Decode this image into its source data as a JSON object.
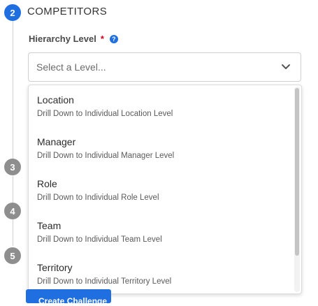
{
  "steps": {
    "active": {
      "number": "2",
      "title": "COMPETITORS"
    },
    "inactive": [
      "3",
      "4",
      "5"
    ]
  },
  "field": {
    "label": "Hierarchy Level",
    "required_mark": "*",
    "help_icon": "question-circle-icon"
  },
  "select": {
    "placeholder": "Select a Level...",
    "chevron_icon": "chevron-down-icon"
  },
  "options": [
    {
      "title": "Location",
      "description": "Drill Down to Individual Location Level"
    },
    {
      "title": "Manager",
      "description": "Drill Down to Individual Manager Level"
    },
    {
      "title": "Role",
      "description": "Drill Down to Individual Role Level"
    },
    {
      "title": "Team",
      "description": "Drill Down to Individual Team Level"
    },
    {
      "title": "Territory",
      "description": "Drill Down to Individual Territory Level"
    }
  ],
  "bottom_button": {
    "label": "Create Challenge"
  },
  "colors": {
    "accent": "#1f6fe0",
    "required": "#d0021b",
    "step_inactive": "#8e8e8e"
  }
}
